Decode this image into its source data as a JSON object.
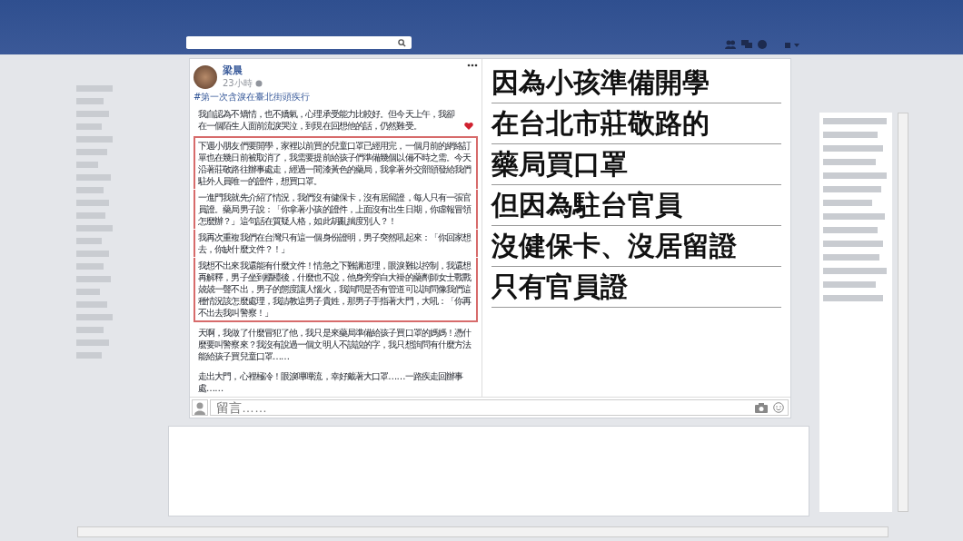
{
  "post": {
    "author": "梁晨",
    "time": "23小時",
    "hashtag": "#第一次含淚在臺北街頭疾行",
    "paragraphs": [
      {
        "text": "我自認為不矯情，也不嬌氣，心理承受能力比較好。但今天上午，我卻在一個陌生人面前流淚哭泣，到現在回想他的話，仍然難受。",
        "highlighted": false,
        "heart": true
      },
      {
        "text": "下週小朋友們要開學，家裡以前買的兒童口罩已經用完，一個月前的網絡訂單也在幾日前被取消了，我需要提前給孩子們準備幾個以備不時之需。今天沿著莊敬路往辦事處走，經過一間漆黃色的藥局，我拿著外交部頒發給我們駐外人員唯一的證件，想買口罩。",
        "highlighted": true
      },
      {
        "text": "一進門我就先介紹了情況，我們沒有健保卡，沒有居留證，每人只有一張官員證。藥局男子說：「你拿著小孩的證件，上面沒有出生日期，你虛報冒領怎麼辦？」這句話在質疑人格，如此胡亂揣度別人？！",
        "highlighted": true
      },
      {
        "text": "我再次重複我們在台灣只有這一個身份證明，男子突然吼起來：「你回家想去，你缺什麼文件？！」",
        "highlighted": true
      },
      {
        "text": "我想不出來我還能有什麼文件！情急之下難講道理，眼淚難以控制，我還想再解釋，男子坐到櫃檯後，什麼也不說，他身旁穿白大褂的藥劑師女士戰戰兢兢一聲不出，男子的態度讓人惱火，我詢問是否有管道可以詢問像我們這種情況該怎麼處理，我請教這男子貴姓，那男子手指著大門，大吼：「你再不出去我叫警察！」",
        "highlighted": true
      },
      {
        "text": "天啊，我做了什麼冒犯了他，我只是來藥局準備給孩子買口罩的媽媽！憑什麼要叫警察來？我沒有說過一個文明人不該說的字，我只想詢問有什麼方法能給孩子買兒童口罩……",
        "highlighted": false
      },
      {
        "text": "走出大門，心裡極冷！眼淚嘩嘩流，幸好戴著大口罩……一路疾走回辦事處……",
        "highlighted": false
      }
    ]
  },
  "caption": [
    "因為小孩準備開學",
    "在台北市莊敬路的",
    "藥局買口罩",
    "但因為駐台官員",
    "沒健保卡、沒居留證",
    "只有官員證"
  ],
  "comment": {
    "placeholder": "留言……"
  }
}
